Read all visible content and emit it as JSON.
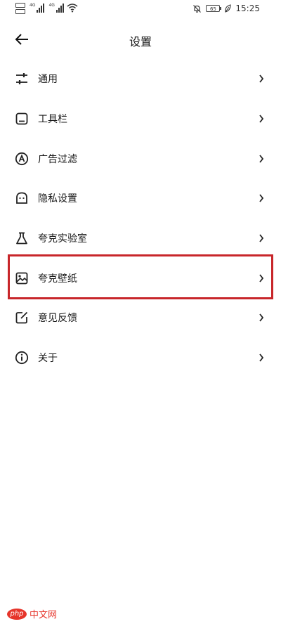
{
  "status_bar": {
    "signal_labels": [
      "4G",
      "4G"
    ],
    "battery": "65",
    "time": "15:25"
  },
  "header": {
    "title": "设置"
  },
  "menu": {
    "items": [
      {
        "label": "通用",
        "icon": "sliders-icon"
      },
      {
        "label": "工具栏",
        "icon": "toolbar-icon"
      },
      {
        "label": "广告过滤",
        "icon": "ad-filter-icon"
      },
      {
        "label": "隐私设置",
        "icon": "privacy-icon"
      },
      {
        "label": "夸克实验室",
        "icon": "flask-icon"
      },
      {
        "label": "夸克壁纸",
        "icon": "wallpaper-icon"
      },
      {
        "label": "意见反馈",
        "icon": "feedback-icon"
      },
      {
        "label": "关于",
        "icon": "info-icon"
      }
    ]
  },
  "highlight_color": "#c8262a"
}
